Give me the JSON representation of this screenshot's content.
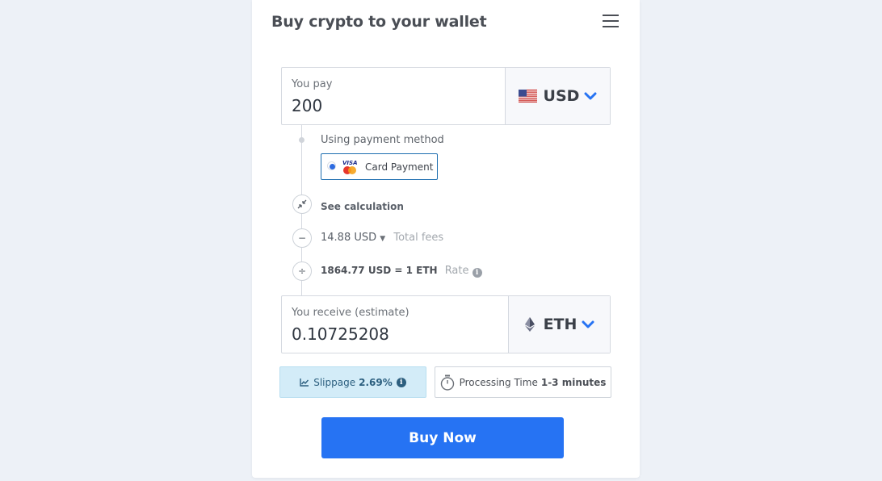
{
  "header": {
    "title": "Buy crypto to your wallet"
  },
  "pay": {
    "label": "You pay",
    "amount": "200",
    "currency": "USD"
  },
  "payment_method": {
    "label": "Using payment method",
    "option": "Card Payment"
  },
  "calc": {
    "see_calculation": "See calculation",
    "fees_value": "14.88 USD",
    "fees_label": "Total fees",
    "rate_value": "1864.77 USD = 1 ETH",
    "rate_label": "Rate"
  },
  "receive": {
    "label": "You receive (estimate)",
    "amount": "0.10725208",
    "currency": "ETH"
  },
  "slippage": {
    "label": "Slippage",
    "value": "2.69%"
  },
  "processing": {
    "label": "Processing Time",
    "value": "1-3 minutes"
  },
  "buy_button": {
    "label": "Buy Now"
  },
  "colors": {
    "accent": "#2673f3",
    "background": "#edf1f7",
    "slippage_bg": "#d3ecf8"
  },
  "icons": [
    "menu-icon",
    "us-flag-icon",
    "chevron-down-icon",
    "compress-icon",
    "minus-icon",
    "divide-icon",
    "info-icon",
    "eth-icon",
    "chart-icon",
    "stopwatch-icon",
    "card-brands-icon"
  ]
}
